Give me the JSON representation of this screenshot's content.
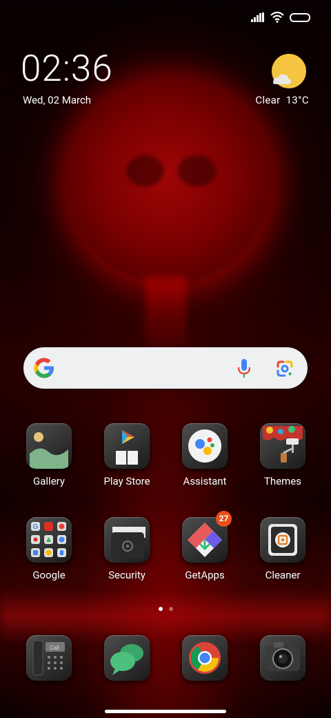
{
  "clock": {
    "time": "02:36",
    "date": "Wed, 02 March"
  },
  "weather": {
    "condition": "Clear",
    "temperature": "13°C",
    "icon": "sun-cloud-icon"
  },
  "search": {
    "provider": "Google",
    "icons": [
      "google-g-icon",
      "mic-icon",
      "lens-icon"
    ]
  },
  "apps_row1": [
    {
      "label": "Gallery"
    },
    {
      "label": "Play Store"
    },
    {
      "label": "Assistant"
    },
    {
      "label": "Themes"
    }
  ],
  "apps_row2": [
    {
      "label": "Google"
    },
    {
      "label": "Security"
    },
    {
      "label": "GetApps",
      "badge": "27"
    },
    {
      "label": "Cleaner"
    }
  ],
  "dock": [
    {
      "name": "Phone",
      "icon_text": "Call"
    },
    {
      "name": "Messages"
    },
    {
      "name": "Chrome"
    },
    {
      "name": "Camera"
    }
  ],
  "page_indicator": {
    "current": 1,
    "total": 2
  },
  "colors": {
    "accent_red": "#c00000",
    "badge": "#ea4f1b",
    "sun": "#f5c542"
  }
}
